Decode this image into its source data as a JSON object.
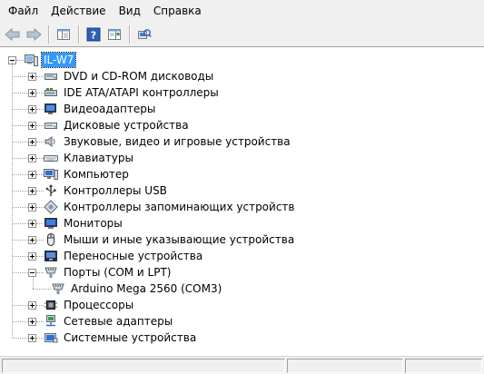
{
  "menu": {
    "file": "Файл",
    "action": "Действие",
    "view": "Вид",
    "help": "Справка"
  },
  "toolbar": {
    "buttons": [
      "back-icon",
      "forward-icon",
      "show-hide-console-tree-icon",
      "help-icon",
      "properties-icon",
      "scan-hardware-icon"
    ]
  },
  "tree": {
    "root": "IL-W7",
    "items": [
      {
        "label": "DVD и CD-ROM дисководы",
        "icon": "dvd-icon"
      },
      {
        "label": "IDE ATA/ATAPI контроллеры",
        "icon": "ide-controller-icon"
      },
      {
        "label": "Видеоадаптеры",
        "icon": "display-adapter-icon"
      },
      {
        "label": "Дисковые устройства",
        "icon": "disk-drive-icon"
      },
      {
        "label": "Звуковые, видео и игровые устройства",
        "icon": "sound-icon"
      },
      {
        "label": "Клавиатуры",
        "icon": "keyboard-icon"
      },
      {
        "label": "Компьютер",
        "icon": "computer-icon"
      },
      {
        "label": "Контроллеры USB",
        "icon": "usb-icon"
      },
      {
        "label": "Контроллеры запоминающих устройств",
        "icon": "storage-controller-icon"
      },
      {
        "label": "Мониторы",
        "icon": "monitor-icon"
      },
      {
        "label": "Мыши и иные указывающие устройства",
        "icon": "mouse-icon"
      },
      {
        "label": "Переносные устройства",
        "icon": "portable-device-icon"
      },
      {
        "label": "Порты (COM и LPT)",
        "icon": "port-icon"
      },
      {
        "label": "Arduino Mega 2560 (COM3)",
        "icon": "port-icon"
      },
      {
        "label": "Процессоры",
        "icon": "processor-icon"
      },
      {
        "label": "Сетевые адаптеры",
        "icon": "network-adapter-icon"
      },
      {
        "label": "Системные устройства",
        "icon": "system-device-icon"
      }
    ]
  }
}
